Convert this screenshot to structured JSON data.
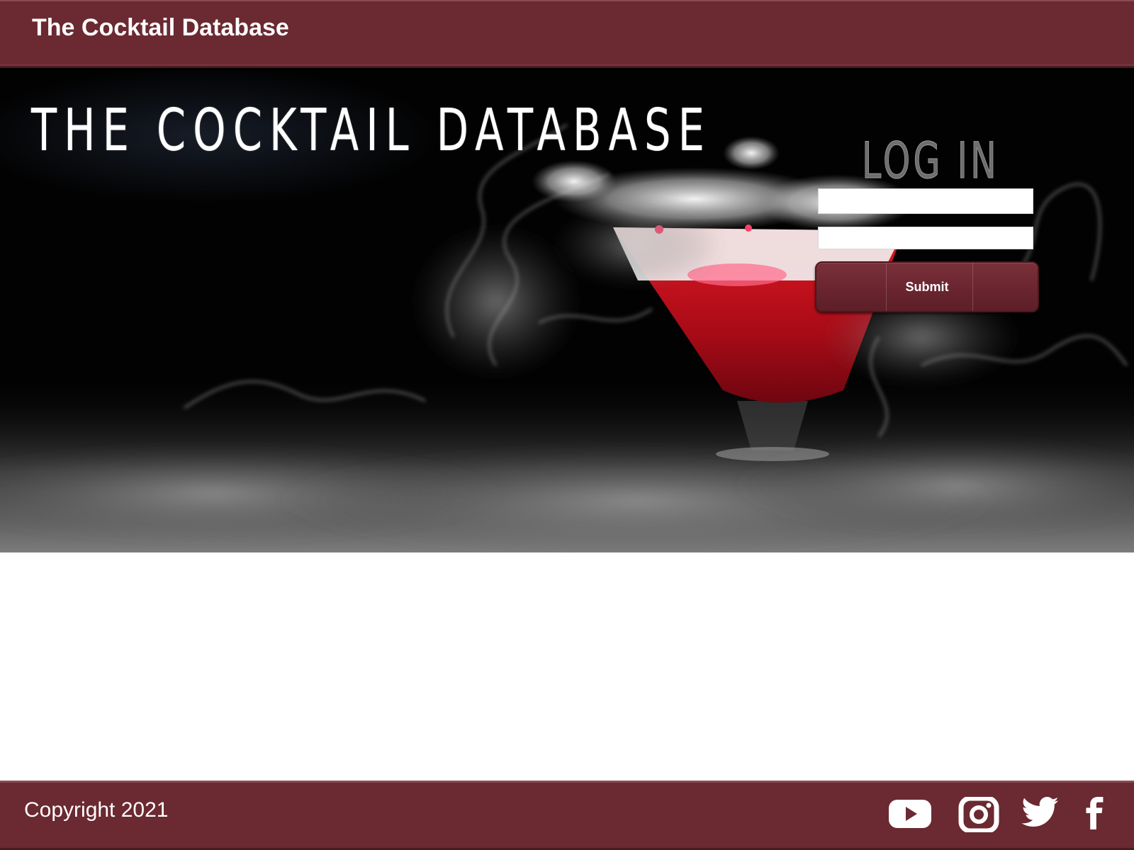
{
  "header": {
    "title": "The Cocktail Database"
  },
  "hero": {
    "title": "THE COCKTAIL DATABASE"
  },
  "login": {
    "heading": "LOG IN",
    "username_value": "",
    "password_value": "",
    "submit_label": "Submit"
  },
  "footer": {
    "copyright": "Copyright 2021",
    "social": [
      "youtube-icon",
      "instagram-icon",
      "twitter-icon",
      "facebook-icon"
    ]
  },
  "colors": {
    "brand": "#6b2931",
    "brand_dark": "#4a1a20",
    "cocktail_red": "#c0101c"
  }
}
